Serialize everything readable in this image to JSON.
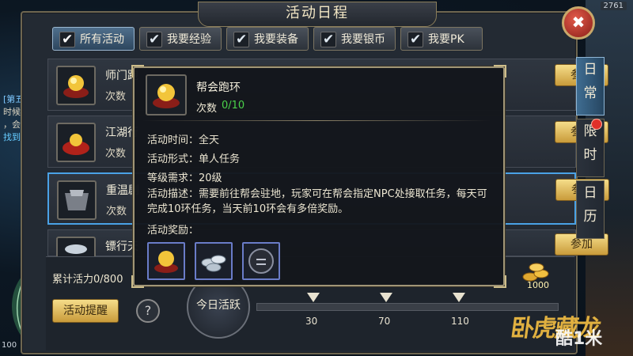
{
  "window": {
    "title": "活动日程",
    "close_label": "✖"
  },
  "hud": {
    "top_number": "2761",
    "bottom_number": "100"
  },
  "side_quest": {
    "tag": "[第五",
    "line1": "时候不",
    "line2": "，会",
    "link": "找到"
  },
  "filter_tabs": [
    {
      "label": "所有活动",
      "active": true
    },
    {
      "label": "我要经验",
      "active": false
    },
    {
      "label": "我要装备",
      "active": false
    },
    {
      "label": "我要银币",
      "active": false
    },
    {
      "label": "我要PK",
      "active": false
    }
  ],
  "side_tabs": [
    {
      "label": "日\n常",
      "active": true
    },
    {
      "label": "限\n时",
      "active": false,
      "badge": true
    },
    {
      "label": "日\n历",
      "active": false
    }
  ],
  "rows": [
    {
      "name": "师门跑",
      "count_label": "次数",
      "join": "参加",
      "icon": "gold-orb-icon"
    },
    {
      "name": "江湖行",
      "count_label": "次数",
      "join": "参加",
      "icon": "red-bag-icon"
    },
    {
      "name": "重温剧",
      "count_label": "次数",
      "join": "参加",
      "icon": "armor-icon"
    },
    {
      "name": "镖行天",
      "count_label": "",
      "join": "参加",
      "icon": "silver-icon"
    }
  ],
  "popup": {
    "title": "帮会跑环",
    "count_label": "次数",
    "count_value": "0/10",
    "time": "活动时间：全天",
    "form": "活动形式：单人任务",
    "level": "等级需求：20级",
    "desc": "活动描述：需要前往帮会驻地，玩家可在帮会指定NPC处接取任务，每天可完成10环任务，当天前10环会有多倍奖励。",
    "reward_label": "活动奖励：",
    "rewards": [
      "gold-orb-icon",
      "silver-coins-icon",
      "dark-token-icon"
    ]
  },
  "bottom": {
    "activity_points": "累计活力0/800",
    "remind_label": "活动提醒",
    "help_label": "?",
    "today_label": "今日活跃",
    "milestones": [
      "30",
      "70",
      "110"
    ],
    "coin_amount": "1000"
  },
  "branding": {
    "logo": "卧虎藏龙",
    "watermark": "酷1米"
  },
  "colors": {
    "accent_gold": "#c99b3a",
    "tab_active": "#2d465e",
    "highlight_border": "#4aa2e6",
    "count_green": "#4ad24a"
  }
}
